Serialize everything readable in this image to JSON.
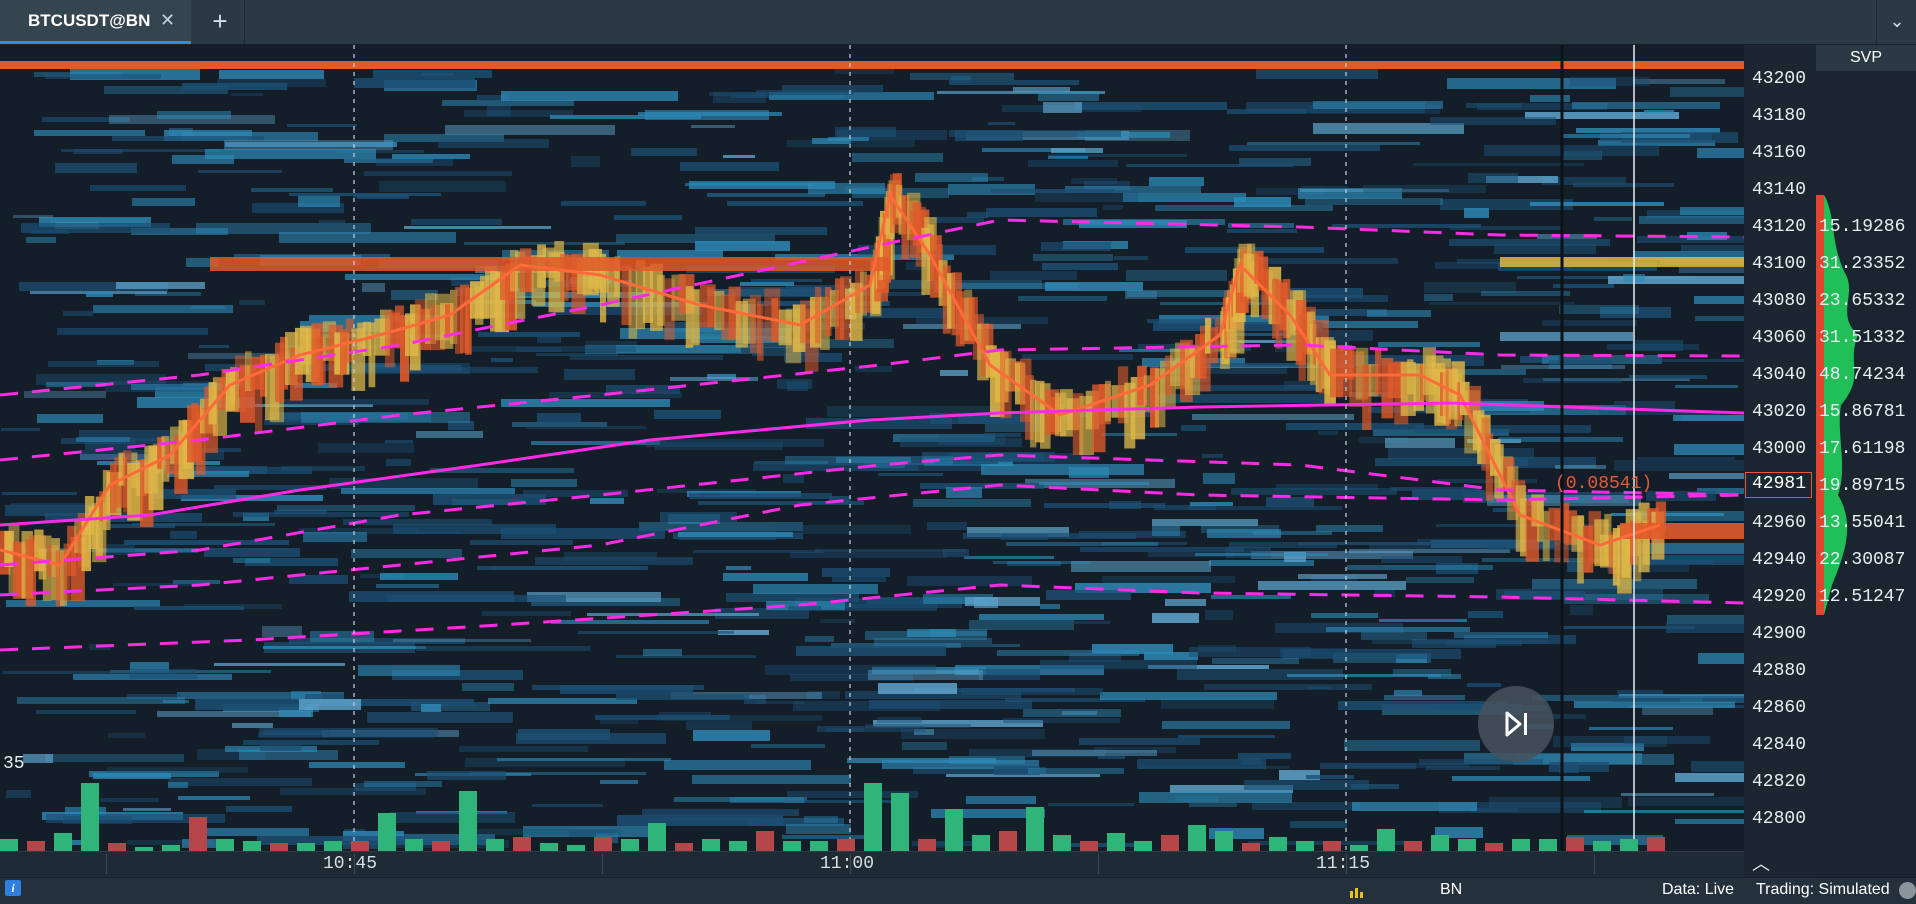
{
  "tabs": [
    {
      "label": "BTCUSDT@BN",
      "active": true
    }
  ],
  "tab_icons": {
    "close": "close-icon",
    "add": "plus-icon",
    "menu": "chevron-down-icon"
  },
  "colors": {
    "background": "#141e28",
    "heat_low": "#1c4f74",
    "heat_mid": "#2e8ab8",
    "heat_high": "#e0b848",
    "heat_peak": "#e05a2a",
    "vwap": "#ff2ae8",
    "price_line": "#ff6a3a",
    "buy_volume": "#2fb57a",
    "sell_volume": "#b5474a",
    "svp_profile": "#21c75a",
    "svp_bar": "#e2452f",
    "accent": "#2f8ee0"
  },
  "price_axis": {
    "ticks": [
      "43200",
      "43180",
      "43160",
      "43140",
      "43120",
      "43100",
      "43080",
      "43060",
      "43040",
      "43020",
      "43000",
      "42960",
      "42940",
      "42920",
      "42900",
      "42880",
      "42860",
      "42840",
      "42820",
      "42800"
    ],
    "current_price": "42981",
    "current_tag": "(0.08541)"
  },
  "time_axis": {
    "labels": [
      "10:45",
      "11:00",
      "11:15"
    ]
  },
  "svp": {
    "title": "SVP",
    "values": [
      "15.19286",
      "31.23352",
      "23.65332",
      "31.51332",
      "48.74234",
      "15.86781",
      "17.61198",
      "19.89715",
      "13.55041",
      "22.30087",
      "12.51247"
    ]
  },
  "side_number": "35",
  "player": {
    "icon": "skip-to-end-icon"
  },
  "status": {
    "info_icon": "info-icon",
    "exchange": "BN",
    "data": "Data: Live",
    "trading": "Trading: Simulated"
  }
}
